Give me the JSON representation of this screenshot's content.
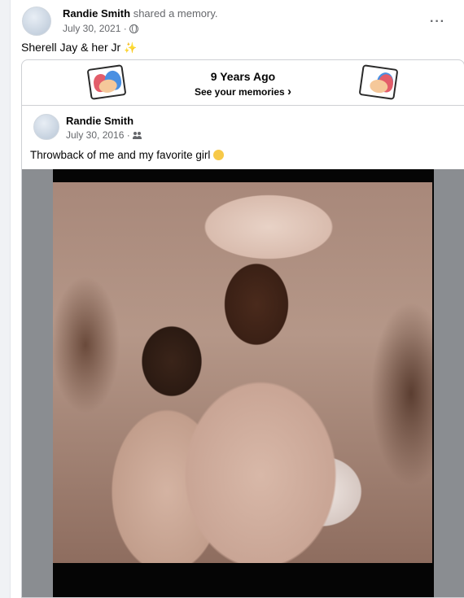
{
  "post": {
    "author": "Randie Smith",
    "action": "shared a memory.",
    "date": "July 30, 2021 ·",
    "caption": "Sherell Jay & her Jr",
    "more_icon": "more-horizontal-icon",
    "privacy_icon": "globe-icon"
  },
  "memory": {
    "years_ago": "9 Years Ago",
    "see_memories": "See your memories",
    "chevron": "›",
    "original": {
      "author": "Randie Smith",
      "date": "July 30, 2016 ·",
      "caption": "Throwback of me and my favorite girl",
      "privacy_icon": "friends-icon"
    }
  },
  "colors": {
    "secondary_text": "#65676b",
    "border": "#ced0d4",
    "background": "#f0f2f5"
  }
}
